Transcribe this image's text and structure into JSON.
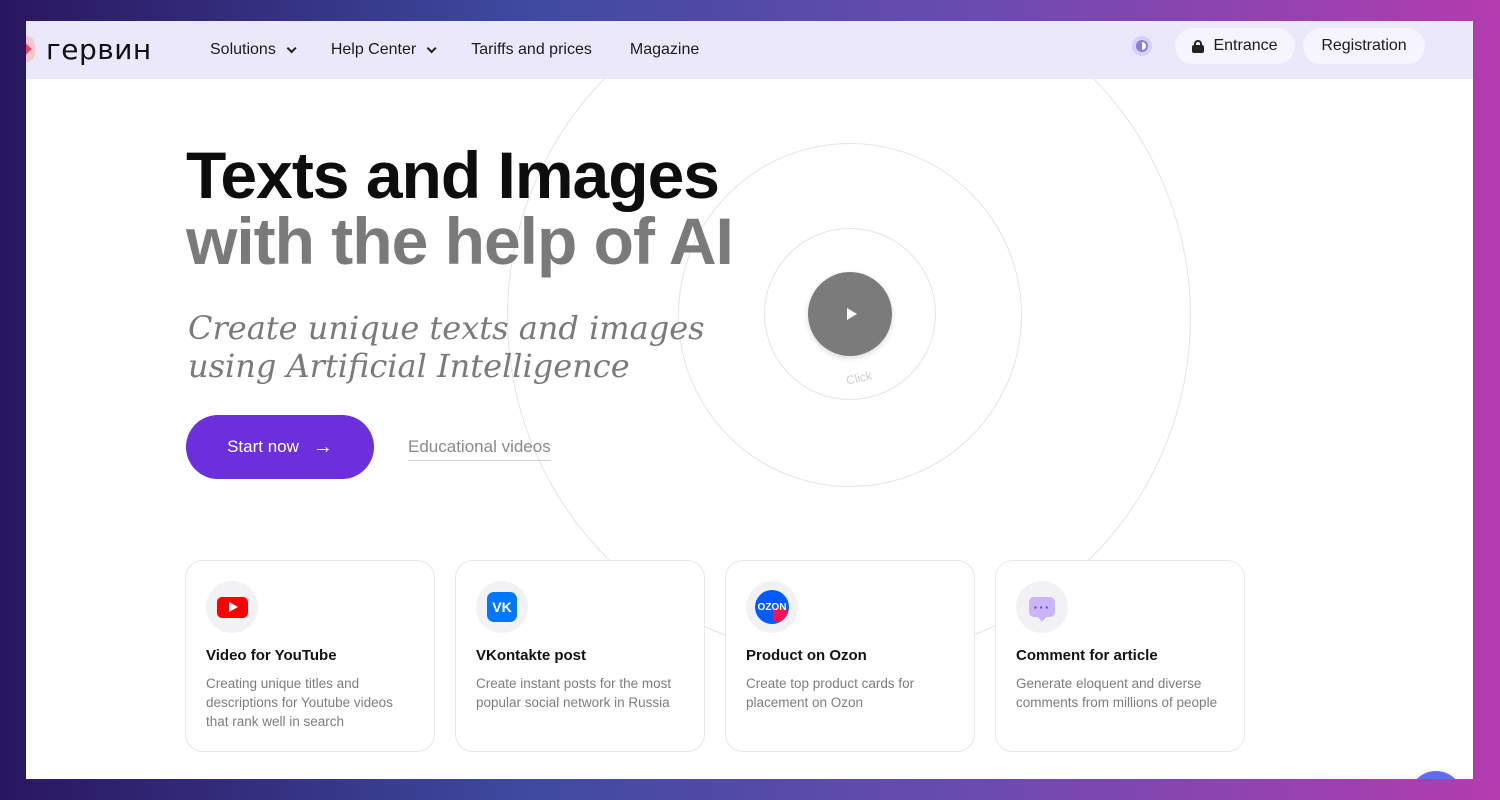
{
  "brand": {
    "logo_text": "гервин"
  },
  "nav": {
    "items": [
      {
        "label": "Solutions",
        "has_dropdown": true
      },
      {
        "label": "Help Center",
        "has_dropdown": true
      },
      {
        "label": "Tariffs and prices",
        "has_dropdown": false
      },
      {
        "label": "Magazine",
        "has_dropdown": false
      }
    ],
    "entrance_label": "Entrance",
    "registration_label": "Registration"
  },
  "hero": {
    "title_line1": "Texts and Images",
    "title_line2": "with the help of AI",
    "subtitle": "Create unique texts and images using Artificial Intelligence",
    "start_label": "Start now",
    "start_arrow": "→",
    "edu_label": "Educational videos",
    "play_label": "Click"
  },
  "cards": [
    {
      "icon": "youtube-icon",
      "title": "Video for YouTube",
      "desc": "Creating unique titles and descriptions for Youtube videos that rank well in search"
    },
    {
      "icon": "vk-icon",
      "title": "VKontakte post",
      "desc": "Create instant posts for the most popular social network in Russia"
    },
    {
      "icon": "ozon-icon",
      "title": "Product on Ozon",
      "desc": "Create top product cards for placement on Ozon"
    },
    {
      "icon": "comment-icon",
      "title": "Comment for article",
      "desc": "Generate eloquent and diverse comments from millions of people"
    }
  ],
  "colors": {
    "accent": "#6b2fdc",
    "header_bg": "#ece8fb",
    "youtube_red": "#ff0000",
    "vk_blue": "#0077ff",
    "ozon_blue": "#005bff",
    "ozon_pink": "#f91155"
  },
  "icons": {
    "vk_glyph": "VK",
    "ozon_glyph": "OZON",
    "comment_glyph": "···"
  }
}
